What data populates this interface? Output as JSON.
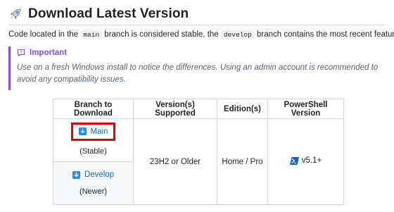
{
  "heading": {
    "title": "Download Latest Version",
    "icon": "rocket-icon"
  },
  "intro": {
    "prefix": "Code located in the ",
    "branch1": "main",
    "middle": " branch is considered stable, the ",
    "branch2": "develop",
    "suffix": " branch contains the most recent features."
  },
  "callout": {
    "icon": "report-icon",
    "title": "Important",
    "body": "Use on a fresh Windows install to notice the differences. Using an admin account is recommended to avoid any compatibility issues.",
    "accent": "#8250df"
  },
  "table": {
    "headers": [
      "Branch to Download",
      "Version(s) Supported",
      "Edition(s)",
      "PowerShell Version"
    ],
    "main": {
      "label": "Main",
      "note": "(Stable)",
      "icon": "download-icon"
    },
    "develop": {
      "label": "Develop",
      "note": "(Newer)",
      "icon": "download-icon"
    },
    "versions": "23H2 or Older",
    "editions": "Home / Pro",
    "powershell": "v5.1+",
    "link_color": "#0969da",
    "highlight_color": "#e60000"
  }
}
